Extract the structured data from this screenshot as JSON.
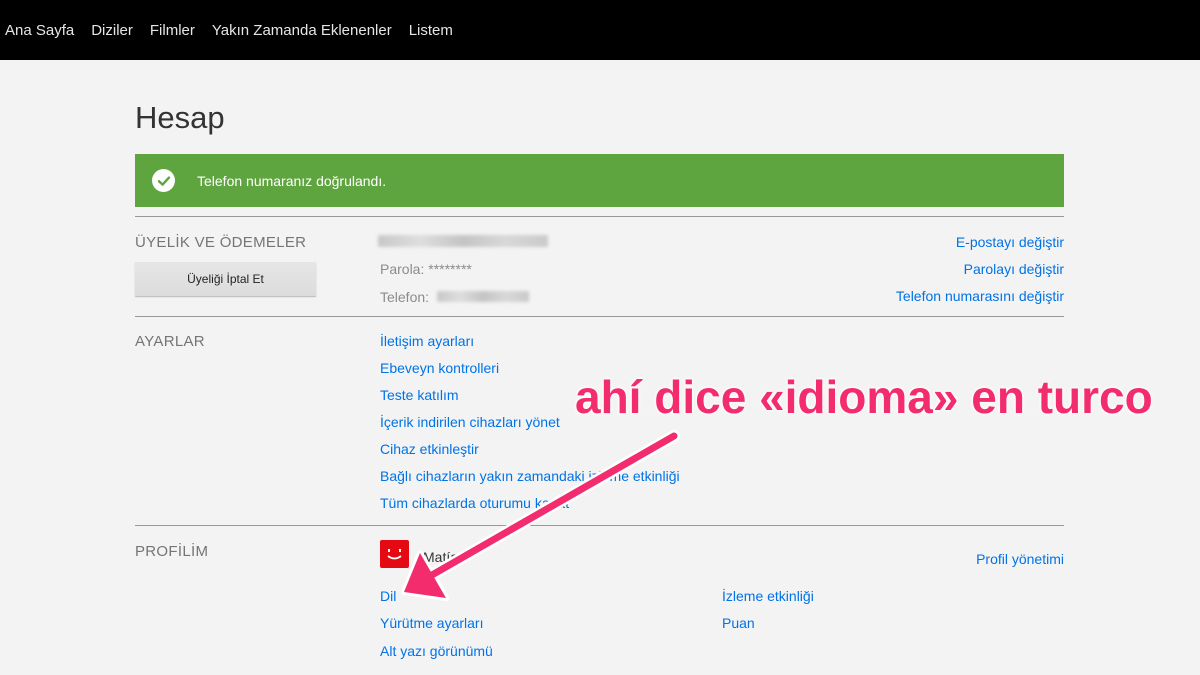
{
  "nav": {
    "items": [
      "Ana Sayfa",
      "Diziler",
      "Filmler",
      "Yakın Zamanda Eklenenler",
      "Listem"
    ]
  },
  "page": {
    "title": "Hesap"
  },
  "banner": {
    "message": "Telefon numaranız doğrulandı.",
    "color": "#5fa53f"
  },
  "membership": {
    "section_title": "ÜYELİK VE ÖDEMELER",
    "cancel_label": "Üyeliği İptal Et",
    "password_label": "Parola: ********",
    "phone_label": "Telefon:",
    "change_email": "E-postayı değiştir",
    "change_password": "Parolayı değiştir",
    "change_phone": "Telefon numarasını değiştir"
  },
  "settings": {
    "section_title": "AYARLAR",
    "links": [
      "İletişim ayarları",
      "Ebeveyn kontrolleri",
      "Teste katılım",
      "İçerik indirilen cihazları yönet",
      "Cihaz etkinleştir",
      "Bağlı cihazların yakın zamandaki izleme etkinliği",
      "Tüm cihazlarda oturumu kapat"
    ]
  },
  "profile": {
    "section_title": "PROFİLİM",
    "name": "Matías",
    "manage": "Profil yönetimi",
    "links_left": [
      "Dil",
      "Yürütme ayarları",
      "Alt yazı görünümü"
    ],
    "links_right": [
      "İzleme etkinliği",
      "Puan"
    ]
  },
  "annotation": {
    "text": "ahí dice «idioma» en turco",
    "color": "#f32c6e"
  },
  "colors": {
    "link": "#0073e6",
    "nav_bg": "#000000",
    "page_bg": "#f3f3f3"
  }
}
